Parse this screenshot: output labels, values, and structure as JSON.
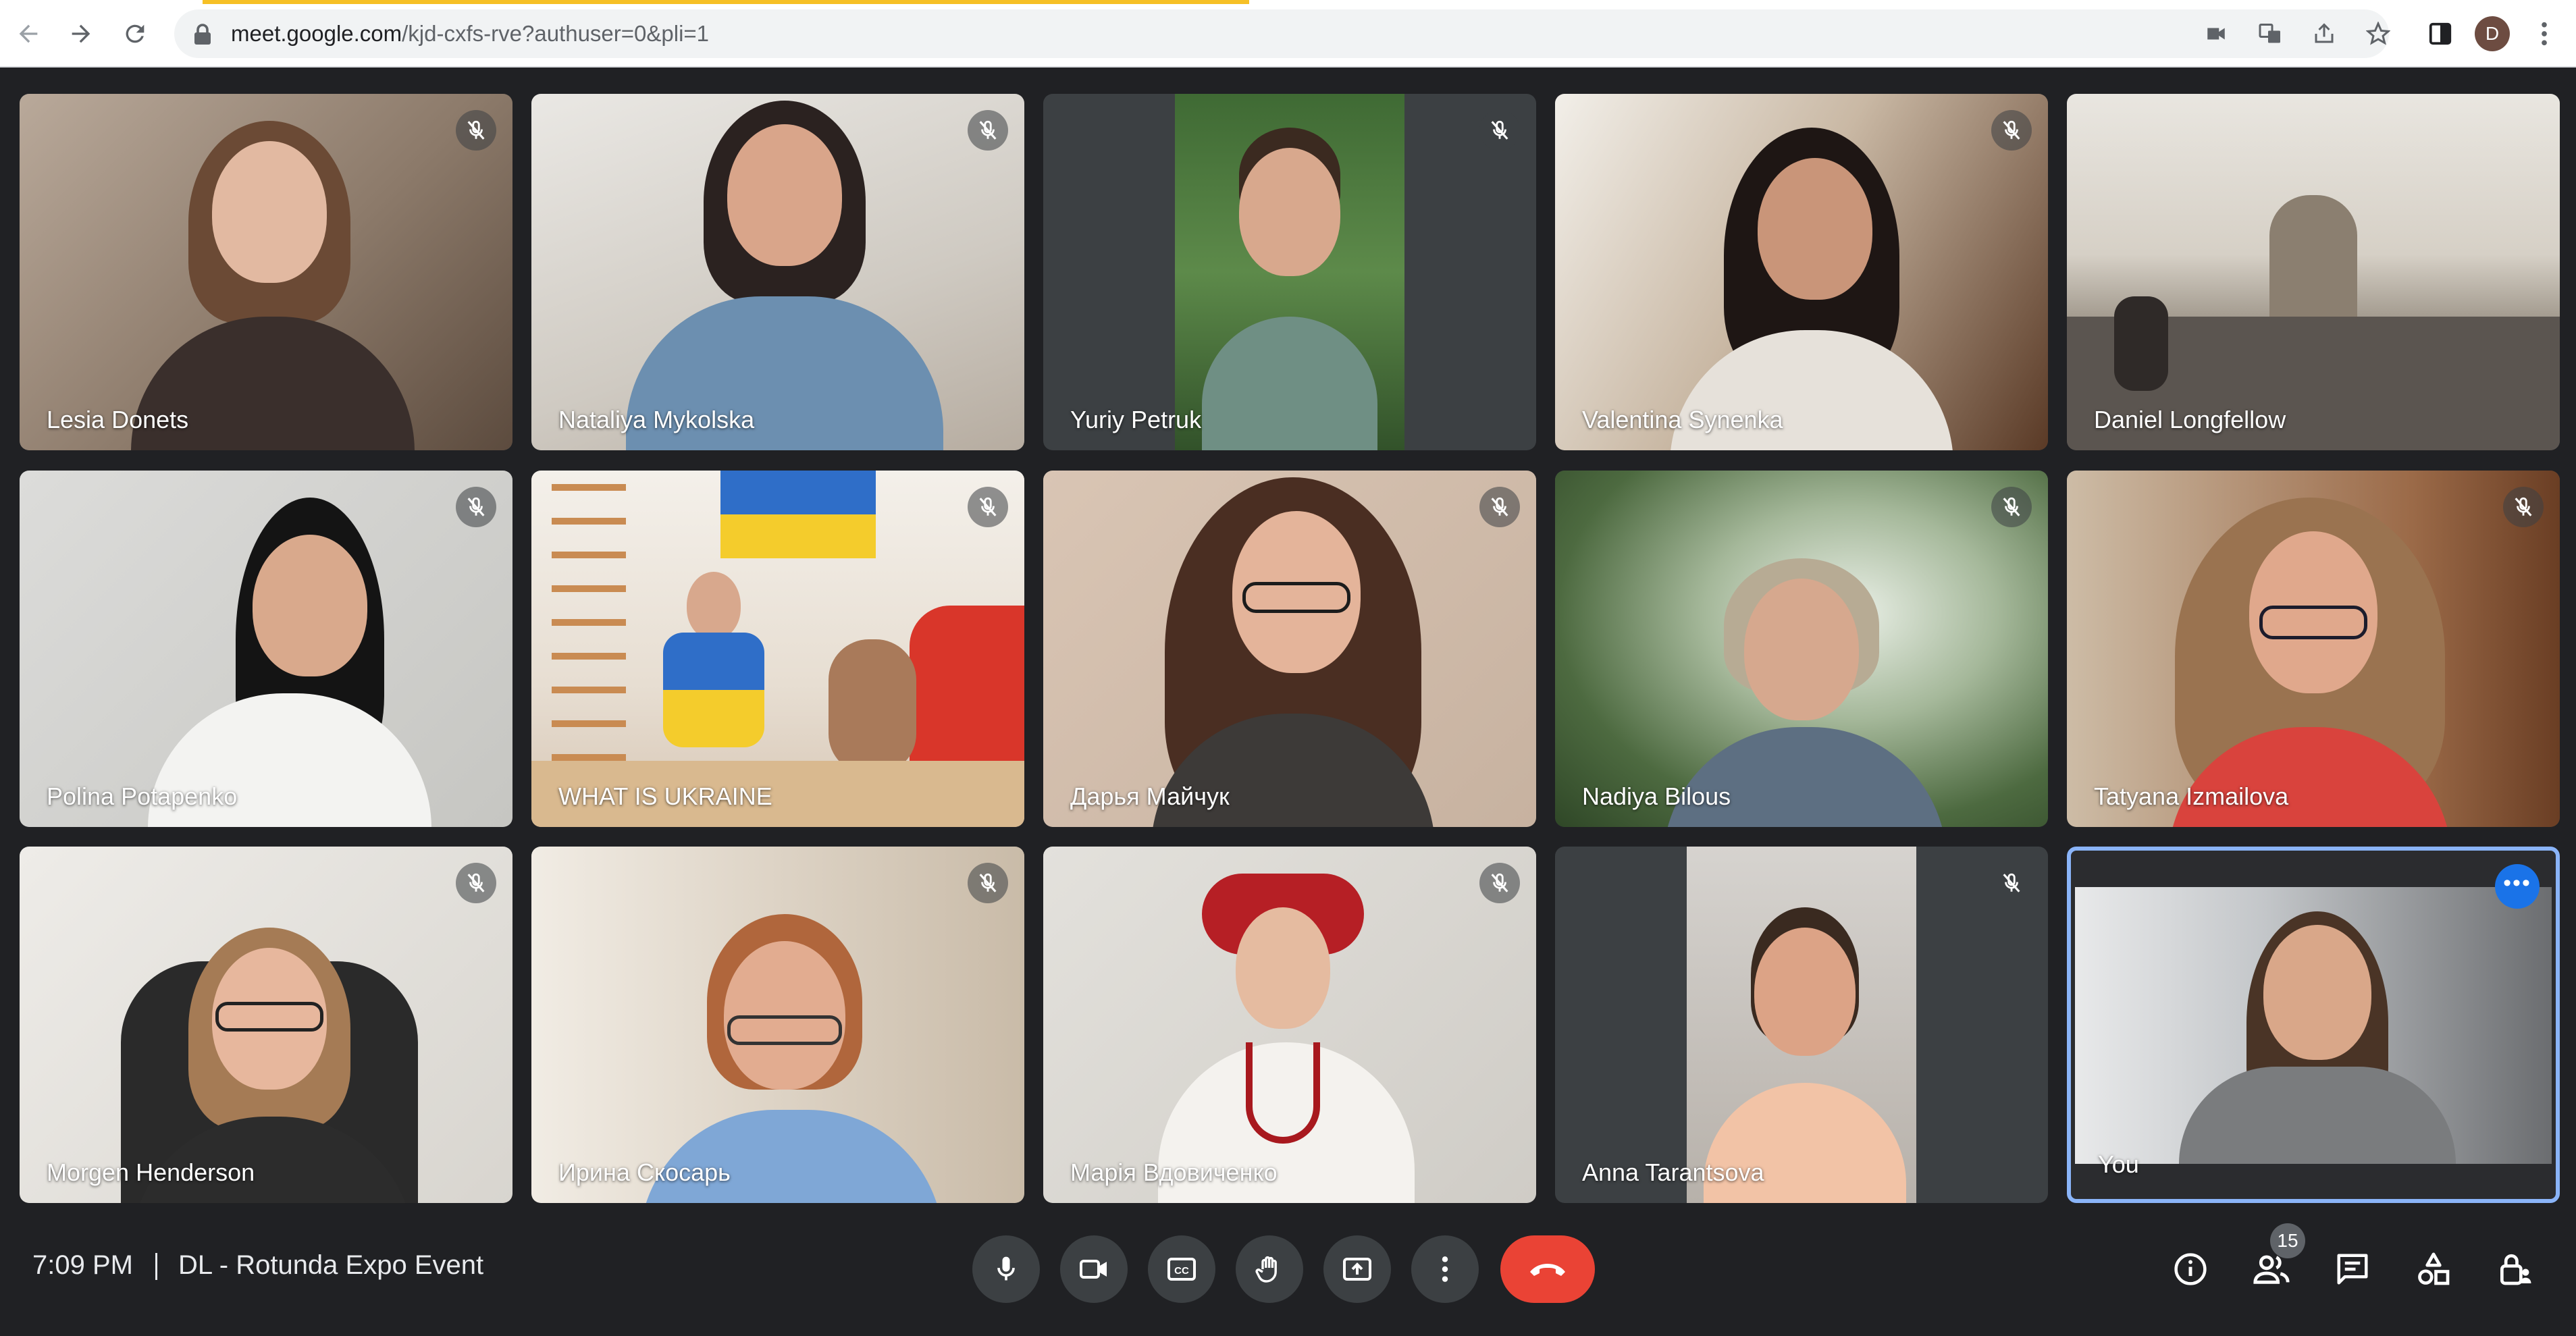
{
  "browser": {
    "url_host": "meet.google.com",
    "url_path": "/kjd-cxfs-rve?authuser=0&pli=1",
    "profile_initial": "D"
  },
  "participants": [
    {
      "name": "Lesia Donets",
      "muted": true
    },
    {
      "name": "Nataliya Mykolska",
      "muted": true
    },
    {
      "name": "Yuriy Petruk",
      "muted": true
    },
    {
      "name": "Valentina Synenka",
      "muted": true
    },
    {
      "name": "Daniel Longfellow",
      "muted": false
    },
    {
      "name": "Polina Potapenko",
      "muted": true
    },
    {
      "name": "WHAT IS UKRAINE",
      "muted": true
    },
    {
      "name": "Дарья Майчук",
      "muted": true
    },
    {
      "name": "Nadiya Bilous",
      "muted": true
    },
    {
      "name": "Tatyana Izmailova",
      "muted": true
    },
    {
      "name": "Morgen Henderson",
      "muted": true
    },
    {
      "name": "Ирина Скосарь",
      "muted": true
    },
    {
      "name": "Марія Вдовиченко",
      "muted": true
    },
    {
      "name": "Anna Tarantsova",
      "muted": true
    },
    {
      "name": "You",
      "muted": false
    }
  ],
  "bottom_bar": {
    "time": "7:09 PM",
    "meeting_title": "DL - Rotunda Expo Event",
    "participant_count": "15"
  },
  "colors": {
    "background": "#202124",
    "control": "#3c4043",
    "hangup": "#ea4335",
    "self_border": "#8ab4f8",
    "accent": "#1a73e8"
  }
}
